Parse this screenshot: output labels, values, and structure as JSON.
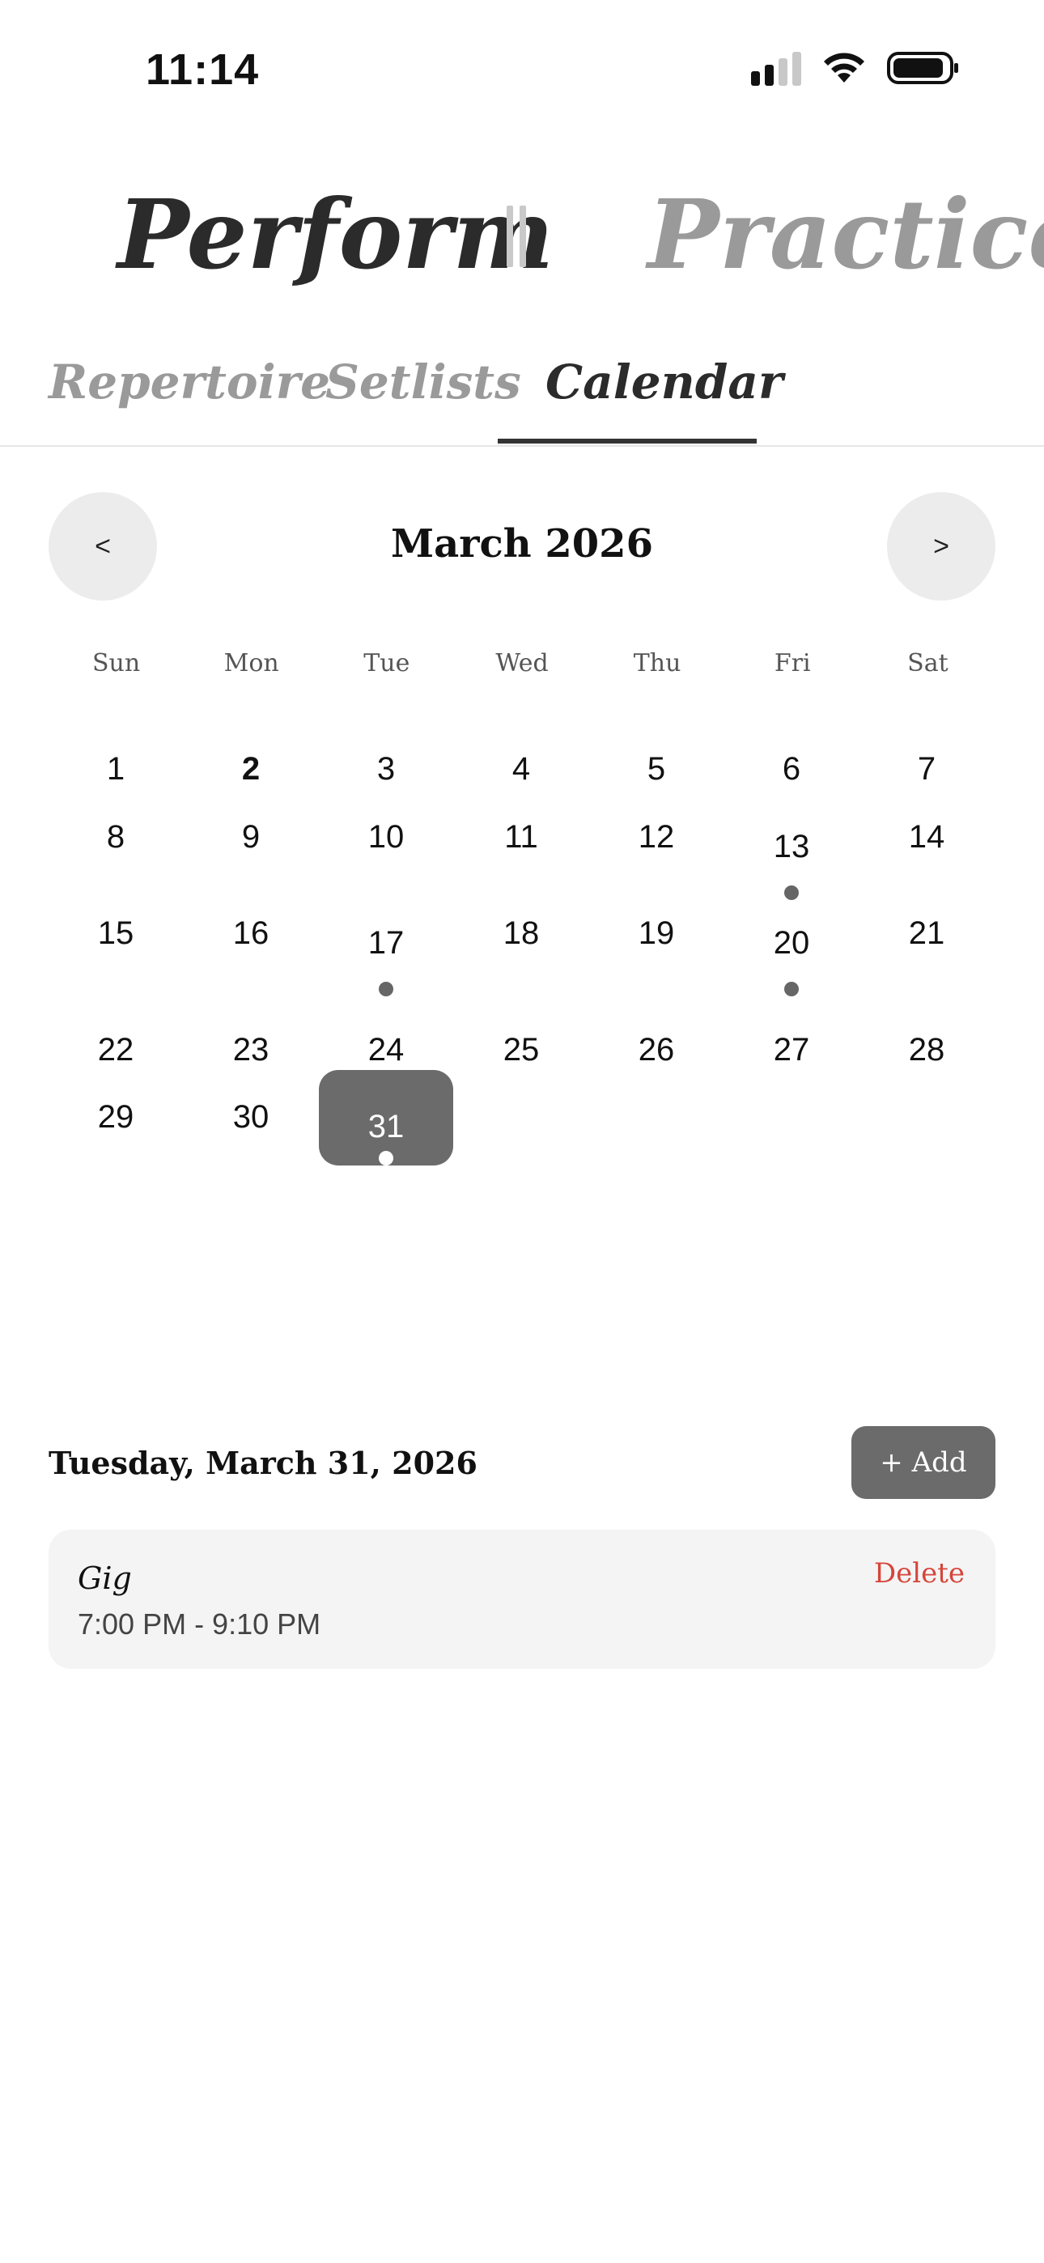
{
  "status_bar": {
    "time": "11:14",
    "icons": [
      "cellular-signal-icon",
      "wifi-icon",
      "battery-icon"
    ]
  },
  "mode_switch": {
    "perform_label": "Perform",
    "divider_icon": "pause-divider-icon",
    "practice_label": "Practice",
    "active": "Perform"
  },
  "tabs": [
    {
      "label": "Repertoire",
      "active": false
    },
    {
      "label": "Setlists",
      "active": false
    },
    {
      "label": "Calendar",
      "active": true
    }
  ],
  "calendar": {
    "prev_label": "<",
    "next_label": ">",
    "month_title": "March 2026",
    "weekdays": [
      "Sun",
      "Mon",
      "Tue",
      "Wed",
      "Thu",
      "Fri",
      "Sat"
    ],
    "days": [
      "1",
      "2",
      "3",
      "4",
      "5",
      "6",
      "7",
      "8",
      "9",
      "10",
      "11",
      "12",
      "13",
      "14",
      "15",
      "16",
      "17",
      "18",
      "19",
      "20",
      "21",
      "22",
      "23",
      "24",
      "25",
      "26",
      "27",
      "28",
      "29",
      "30",
      "31"
    ],
    "today": "2",
    "selected": "31",
    "event_days": [
      "13",
      "17",
      "20",
      "31"
    ]
  },
  "selected_day": {
    "date_label": "Tuesday, March 31, 2026",
    "add_label": "+ Add"
  },
  "events": [
    {
      "title": "Gig",
      "time": "7:00 PM - 9:10 PM",
      "delete_label": "Delete"
    }
  ],
  "colors": {
    "accent_gray": "#6b6b6b",
    "delete_red": "#d6453a",
    "inactive_text": "#9a9a9a",
    "card_bg": "#f4f4f4"
  }
}
